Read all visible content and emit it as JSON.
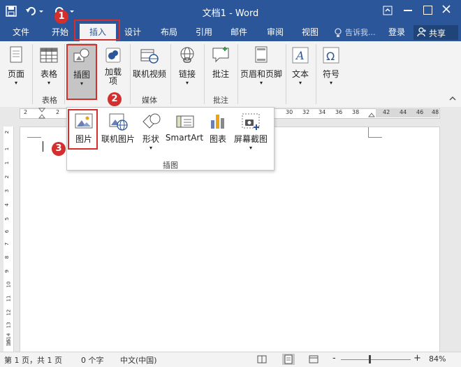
{
  "title_bar": {
    "doc_title": "文档1 - Word",
    "save_icon": "save-icon",
    "undo_icon": "undo-icon",
    "redo_icon": "redo-icon",
    "controls": [
      "restore-ribbon-icon",
      "minimize-icon",
      "maximize-icon",
      "close-icon"
    ]
  },
  "tabs": [
    {
      "label": "文件"
    },
    {
      "label": "开始"
    },
    {
      "label": "插入"
    },
    {
      "label": "设计"
    },
    {
      "label": "布局"
    },
    {
      "label": "引用"
    },
    {
      "label": "邮件"
    },
    {
      "label": "审阅"
    },
    {
      "label": "视图"
    }
  ],
  "tell_me": "告诉我...",
  "login": "登录",
  "share": "共享",
  "ribbon": {
    "buttons": {
      "pages": "页面",
      "table": "表格",
      "illustrations": "插图",
      "addins": "加载\n项",
      "online_video": "联机视频",
      "link": "链接",
      "comment": "批注",
      "header_footer": "页眉和页脚",
      "text": "文本",
      "symbol": "符号"
    },
    "groups": {
      "table": "表格",
      "media": "媒体",
      "comments": "批注"
    }
  },
  "dropdown": {
    "items": [
      "图片",
      "联机图片",
      "形状",
      "SmartArt",
      "图表",
      "屏幕截图"
    ],
    "group_label": "插图"
  },
  "ruler": {
    "left_ticks": [
      "2",
      "2"
    ],
    "right_ticks": [
      "30",
      "32",
      "34",
      "36",
      "38",
      "42",
      "44",
      "46",
      "48"
    ]
  },
  "vruler": [
    "2",
    "1",
    "1",
    "2",
    "3",
    "4",
    "5",
    "6",
    "7",
    "8",
    "9",
    "10",
    "11",
    "12",
    "13",
    "14",
    "15",
    "16"
  ],
  "status": {
    "page": "第 1 页，共 1 页",
    "words": "0 个字",
    "lang": "中文(中国)",
    "zoom": "84%",
    "zoom_minus": "-",
    "zoom_plus": "+"
  },
  "annotations": [
    "1",
    "2",
    "3"
  ],
  "colors": {
    "brand": "#2b579a",
    "annotation": "#d32f2f"
  }
}
